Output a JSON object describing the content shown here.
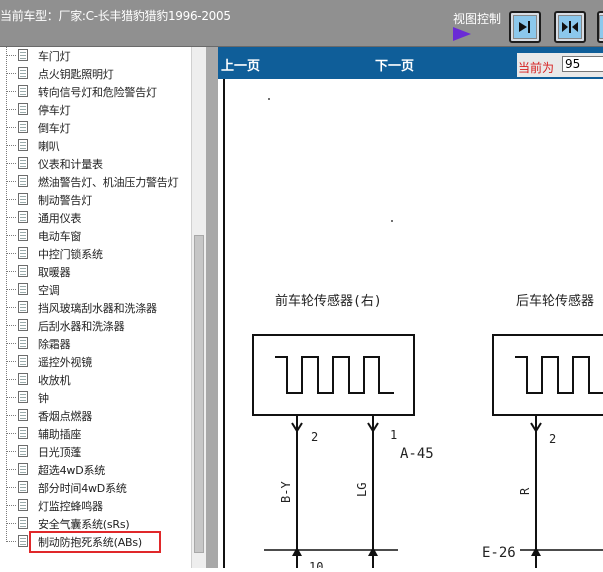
{
  "header": {
    "title": "当前车型：厂家:C-长丰猎豹猎豹1996-2005",
    "view_control_label": "视图控制",
    "buttons": [
      "arrow-right-bar-icon",
      "arrows-inward-icon",
      "arrow-left-bar-icon"
    ]
  },
  "tree": {
    "items": [
      "车门灯",
      "点火钥匙照明灯",
      "转向信号灯和危险警告灯",
      "停车灯",
      "倒车灯",
      "喇叭",
      "仪表和计量表",
      "燃油警告灯、机油压力警告灯",
      "制动警告灯",
      "通用仪表",
      "电动车窗",
      "中控门锁系统",
      "取暖器",
      "空调",
      "挡风玻璃刮水器和洗涤器",
      "后刮水器和洗涤器",
      "除霜器",
      "遥控外视镜",
      "收放机",
      "钟",
      "香烟点燃器",
      "辅助插座",
      "日光顶蓬",
      "超选4wD系统",
      "部分时间4wD系统",
      "灯监控蜂鸣器",
      "安全气囊系统(sRs)",
      "制动防抱死系统(ABs)"
    ],
    "selected_index": 27
  },
  "nav": {
    "prev": "上一页",
    "next": "下一页",
    "current_label": "当前为",
    "current_page": "95"
  },
  "diagram": {
    "front_sensor_title": "前车轮传感器(右)",
    "rear_sensor_title": "后车轮传感器",
    "connector_a": "A-45",
    "connector_e": "E-26",
    "pin_2": "2",
    "pin_1": "1",
    "pin_2b": "2",
    "wire_by": "B-Y",
    "wire_lg": "LG",
    "wire_r": "R",
    "bottom_num": "10"
  },
  "colors": {
    "topbar": "#909090",
    "navbar": "#0f5e99",
    "highlight": "#e0282a",
    "page_label": "#d61f1f"
  }
}
